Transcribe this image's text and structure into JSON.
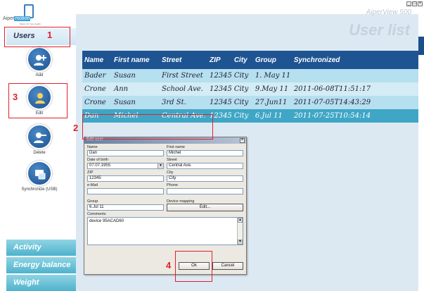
{
  "brand": "AiperView 500",
  "page_title": "User list",
  "sidebar": {
    "logo_text_prefix": "Aiper",
    "logo_text_highlight": "motion",
    "logo_subtitle": "Motion for Your Health",
    "users_label": "Users",
    "actions": [
      {
        "label": "Add",
        "icon": "add-user-icon"
      },
      {
        "label": "Edit",
        "icon": "edit-user-icon"
      },
      {
        "label": "Delete",
        "icon": "delete-user-icon"
      },
      {
        "label": "Synchronize (USB)",
        "icon": "synchronize-icon"
      }
    ],
    "bottom_items": [
      "Activity",
      "Energy balance",
      "Weight"
    ]
  },
  "table": {
    "columns": [
      "Name",
      "First name",
      "Street",
      "ZIP",
      "City",
      "Group",
      "Synchronized"
    ],
    "rows": [
      [
        "Bader",
        "Susan",
        "First Street",
        "12345",
        "City",
        "1. May 11",
        ""
      ],
      [
        "Crone",
        "Ann",
        "School Ave.",
        "12345",
        "City",
        "9.May 11",
        "2011-06-08T11:51:17"
      ],
      [
        "Crone",
        "Susan",
        "3rd St.",
        "12345",
        "City",
        "27.Jun11",
        "2011-07-05T14:43:29"
      ],
      [
        "Dan",
        "Michel",
        "Central Ave.",
        "12345",
        "City",
        "6.Jul 11",
        "2011-07-25T10:54:14"
      ]
    ],
    "selected_row": 3
  },
  "dialog": {
    "title": "Edit user",
    "name_label": "Name",
    "name_value": "Dan",
    "first_name_label": "First name",
    "first_name_value": "Michel",
    "dob_label": "Date of birth",
    "dob_value": "07.07.1955",
    "street_label": "Street",
    "street_value": "Central Ave.",
    "zip_label": "ZIP",
    "zip_value": "12345",
    "city_label": "City",
    "city_value": "City",
    "email_label": "e-Mail",
    "email_value": "",
    "phone_label": "Phone",
    "phone_value": "",
    "group_label": "Group",
    "group_value": "6.Jul 11",
    "device_mapping_label": "Device mapping",
    "edit_button": "Edit...",
    "comments_label": "Comments",
    "comments_value": "device 95ACAD60",
    "ok_button": "Ok",
    "cancel_button": "Cancel"
  },
  "annotations": [
    "1",
    "2",
    "3",
    "4"
  ],
  "colors": {
    "header_blue": "#1f5492",
    "selected_row": "#3fa6c6",
    "annotation_red": "#e2202a"
  }
}
